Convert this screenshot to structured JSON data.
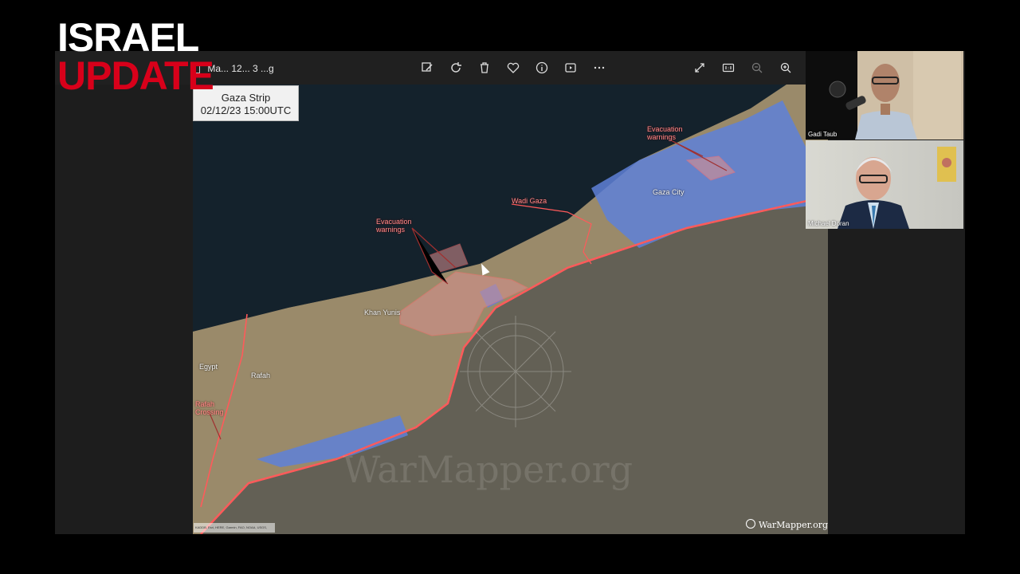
{
  "brand": {
    "line1": "ISRAEL",
    "line2": "UPDATE"
  },
  "viewer": {
    "file_name": "Ma... 12... 3 ...g",
    "toolbar_center": [
      "edit-icon",
      "rotate-icon",
      "delete-icon",
      "favorite-icon",
      "info-icon",
      "slideshow-icon",
      "more-icon"
    ],
    "toolbar_right": [
      "fullscreen-icon",
      "actual-size-icon",
      "zoom-out-icon",
      "zoom-in-icon"
    ]
  },
  "map": {
    "title": "Gaza Strip",
    "timestamp": "02/12/23 15:00UTC",
    "labels": {
      "evac_north": "Evacuation warnings",
      "evac_center": "Evacuation warnings",
      "wadi_gaza": "Wadi Gaza",
      "gaza_city": "Gaza City",
      "khan_yunis": "Khan Yunis",
      "egypt": "Egypt",
      "rafah": "Rafah",
      "rafah_crossing": "Rafah Crossing"
    },
    "attribution": "KADDB, Esri, HERE, Garmin, FAO, NOAA, USGS, NASA, NGA, Foursquare, METI, GEBCO",
    "watermark": "WarMapper.org",
    "colors": {
      "sea": "#14222c",
      "land": "#7a6e58",
      "warning_zone": "#5e80d8",
      "border": "#ff5a5a"
    }
  },
  "participants": [
    {
      "name": "Gadi Taub"
    },
    {
      "name": "Michael Doran"
    }
  ]
}
